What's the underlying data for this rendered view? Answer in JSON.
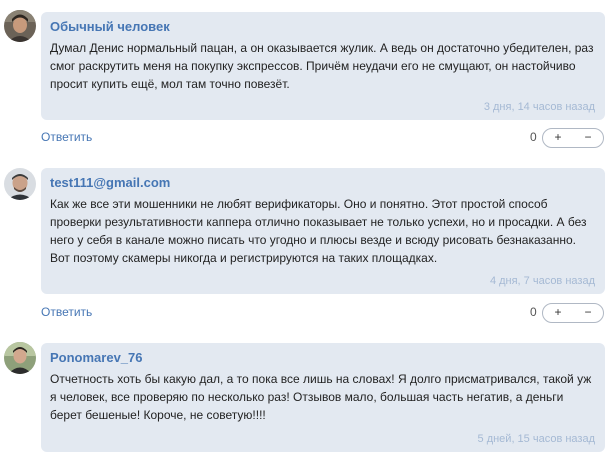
{
  "comments": [
    {
      "author": "Обычный человек",
      "text": "Думал Денис нормальный пацан, а он оказывается жулик. А ведь он достаточно убедителен, раз смог раскрутить меня на покупку экспрессов. Причём неудачи его не смущают, он настойчиво просит купить ещё, мол там точно повезёт.",
      "time": "3 дня, 14 часов назад",
      "reply_label": "Ответить",
      "score": "0",
      "plus_label": "+",
      "minus_label": "−"
    },
    {
      "author": "test111@gmail.com",
      "text": "Как же все эти мошенники не любят верификаторы. Оно и понятно. Этот простой способ проверки результативности каппера отлично показывает не только успехи, но и просадки. А без него у себя в канале можно писать что угодно и плюсы везде и всюду рисовать безнаказанно. Вот поэтому скамеры никогда и регистрируются на таких площадках.",
      "time": "4 дня, 7 часов назад",
      "reply_label": "Ответить",
      "score": "0",
      "plus_label": "+",
      "minus_label": "−"
    },
    {
      "author": "Ponomarev_76",
      "text": "Отчетность хоть бы какую дал, а то пока все лишь на словах! Я долго присматривался, такой уж я человек, все проверяю по несколько раз! Отзывов мало, большая часть негатив, а деньги берет бешеные! Короче, не советую!!!!",
      "time": "5 дней, 15 часов назад"
    }
  ]
}
